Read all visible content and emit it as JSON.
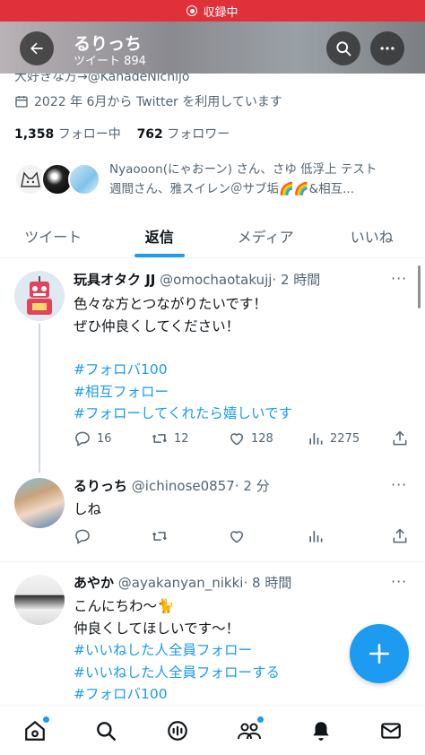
{
  "status_bar": {
    "recording_label": "収録中",
    "icon": "record-icon"
  },
  "header": {
    "name": "るりっち",
    "tweet_count": "ツイート 894",
    "back_icon": "arrow-left-icon",
    "search_icon": "search-icon",
    "more_icon": "more-horizontal-icon"
  },
  "profile": {
    "bio_partial": "大好きな方→@KanadeNichijo",
    "joined": "2022 年 6月から Twitter を利用しています",
    "following_count": "1,358",
    "following_label": "フォロー中",
    "followers_count": "762",
    "followers_label": "フォロワー",
    "followed_by_line1": "Nyaooon(にゃおーン) さん、さゆ 低浮上 テスト",
    "followed_by_line2": "週間さん、雅スイレン＠サブ垢🌈🌈&相互..."
  },
  "tabs": [
    {
      "label": "ツイート",
      "active": false
    },
    {
      "label": "返信",
      "active": true
    },
    {
      "label": "メディア",
      "active": false
    },
    {
      "label": "いいね",
      "active": false
    }
  ],
  "tweets": [
    {
      "name": "玩具オタク JJ",
      "handle": "@omochaotakujj",
      "time": "· 2 時間",
      "lines": [
        "色々な方とつながりたいです！",
        "ぜひ仲良くしてください！"
      ],
      "hashtags": [
        "#フォロバ100",
        "#相互フォロー",
        "#フォローしてくれたら嬉しいです"
      ],
      "replies": "16",
      "retweets": "12",
      "likes": "128",
      "views": "2275"
    },
    {
      "name": "るりっち",
      "handle": "@ichinose0857",
      "time": "· 2 分",
      "lines": [
        "しね"
      ]
    },
    {
      "name": "あやか",
      "handle": "@ayakanyan_nikki",
      "time": "· 8 時間",
      "lines": [
        "こんにちわ〜🐈",
        "仲良くしてほしいです〜！"
      ],
      "hashtags": [
        "#いいねした人全員フォロー",
        "#いいねした人全員フォローする",
        "#フォロバ100"
      ]
    }
  ],
  "more_glyph": "···",
  "fab": {
    "icon": "compose-plus-icon"
  },
  "bottom_nav": [
    "home-icon",
    "search-icon",
    "spaces-icon",
    "communities-icon",
    "notifications-icon",
    "messages-icon"
  ],
  "colors": {
    "accent": "#1d9bf0",
    "recording": "#e0313a",
    "text_secondary": "#536471"
  }
}
